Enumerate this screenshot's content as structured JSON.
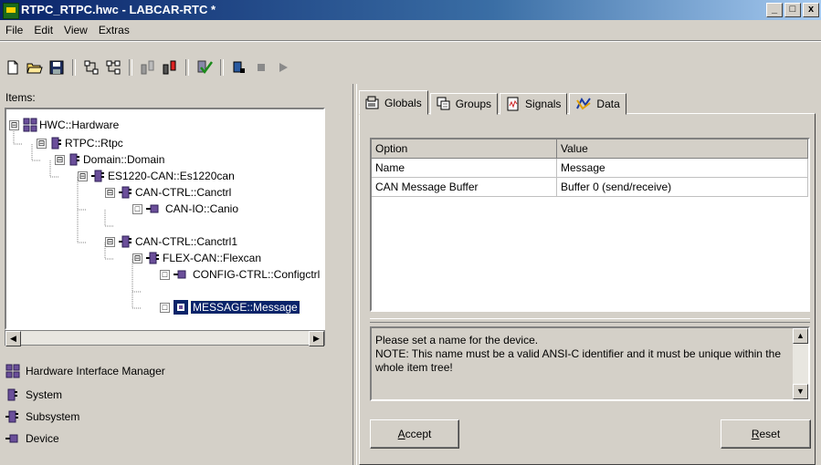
{
  "window": {
    "title": "RTPC_RTPC.hwc - LABCAR-RTC  *",
    "controls": [
      "_",
      "□",
      "x"
    ]
  },
  "menu": [
    "File",
    "Edit",
    "View",
    "Extras"
  ],
  "left": {
    "items_label": "Items:",
    "tree": [
      {
        "label": "HWC::Hardware",
        "level": 0,
        "icon": "hardware-icon",
        "expander": "⊟"
      },
      {
        "label": "RTPC::Rtpc",
        "level": 1,
        "icon": "system-icon",
        "expander": "⊟"
      },
      {
        "label": "Domain::Domain",
        "level": 2,
        "icon": "system-icon",
        "expander": "⊟"
      },
      {
        "label": "ES1220-CAN::Es1220can",
        "level": 3,
        "icon": "subsystem-icon",
        "expander": "⊟"
      },
      {
        "label": "CAN-CTRL::Canctrl",
        "level": 4,
        "icon": "subsystem-icon",
        "expander": "⊟"
      },
      {
        "label": "CAN-IO::Canio",
        "level": 5,
        "icon": "device-icon",
        "expander": "□"
      },
      {
        "label": "CAN-CTRL::Canctrl1",
        "level": 4,
        "icon": "subsystem-icon",
        "expander": "⊟"
      },
      {
        "label": "FLEX-CAN::Flexcan",
        "level": 5,
        "icon": "subsystem-icon",
        "expander": "⊟"
      },
      {
        "label": "CONFIG-CTRL::Configctrl",
        "level": 6,
        "icon": "device-icon",
        "expander": "□"
      },
      {
        "label": "MESSAGE::Message",
        "level": 6,
        "icon": "device-icon",
        "expander": "□",
        "selected": true
      }
    ],
    "legend": [
      {
        "label": "Hardware Interface Manager",
        "icon": "hardware-icon"
      },
      {
        "label": "System",
        "icon": "system-icon"
      },
      {
        "label": "Subsystem",
        "icon": "subsystem-icon"
      },
      {
        "label": "Device",
        "icon": "device-icon"
      }
    ]
  },
  "tabs": [
    {
      "label": "Globals",
      "icon": "globals-icon",
      "active": true
    },
    {
      "label": "Groups",
      "icon": "groups-icon"
    },
    {
      "label": "Signals",
      "icon": "signals-icon"
    },
    {
      "label": "Data",
      "icon": "data-icon"
    }
  ],
  "grid": {
    "columns": [
      "Option",
      "Value"
    ],
    "rows": [
      [
        "Name",
        "Message"
      ],
      [
        "CAN Message Buffer",
        "Buffer 0 (send/receive)"
      ]
    ]
  },
  "help": {
    "lines": [
      "Please set a name for the device.",
      "NOTE: This name must be a valid ANSI-C identifier and it must be unique within the whole item tree!"
    ]
  },
  "buttons": {
    "accept": {
      "mnemonic": "A",
      "rest": "ccept"
    },
    "reset": {
      "mnemonic": "R",
      "rest": "eset"
    }
  }
}
